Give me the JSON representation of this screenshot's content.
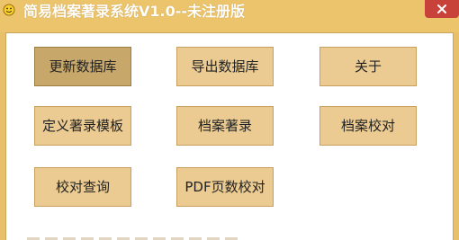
{
  "window": {
    "title": "简易档案著录系统V1.0--未注册版"
  },
  "buttons": {
    "update_db": "更新数据库",
    "export_db": "导出数据库",
    "about": "关于",
    "define_template": "定义著录模板",
    "archive_catalog": "档案著录",
    "archive_proofread": "档案校对",
    "proofread_query": "校对查询",
    "pdf_page_check": "PDF页数校对"
  },
  "colors": {
    "title_bar": "#ecc46c",
    "button_fill": "#ebcb91",
    "button_active_fill": "#c7a76a",
    "close_button": "#c9423a"
  },
  "icons": {
    "app": "smiley-icon",
    "close": "close-icon"
  }
}
